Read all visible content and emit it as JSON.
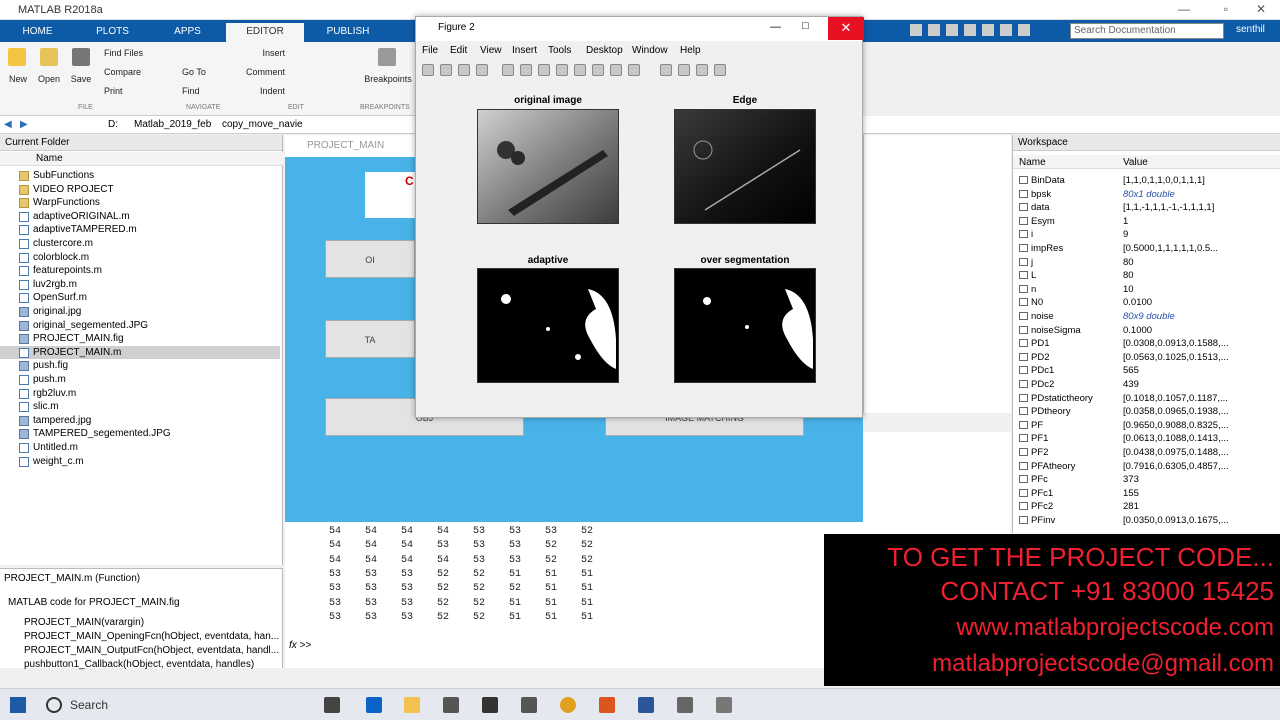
{
  "app": {
    "title": "MATLAB R2018a",
    "tabs": [
      "HOME",
      "PLOTS",
      "APPS",
      "EDITOR",
      "PUBLISH"
    ],
    "active_tab": "EDITOR",
    "search_placeholder": "Search Documentation",
    "user": "senthil"
  },
  "ribbon": {
    "new": "New",
    "open": "Open",
    "save": "Save",
    "find_files": "Find Files",
    "compare": "Compare",
    "print": "Print",
    "go_to": "Go To",
    "find": "Find",
    "comment": "Comment",
    "insert": "Insert",
    "indent": "Indent",
    "breakpoints": "Breakpoints",
    "sections": [
      "FILE",
      "NAVIGATE",
      "EDIT",
      "BREAKPOINTS"
    ]
  },
  "path": [
    "D:",
    "Matlab_2019_feb",
    "copy_move_navie"
  ],
  "current_folder": {
    "title": "Current Folder",
    "col_name": "Name",
    "items": [
      {
        "name": "SubFunctions",
        "type": "folder"
      },
      {
        "name": "VIDEO RPOJECT",
        "type": "folder"
      },
      {
        "name": "WarpFunctions",
        "type": "folder"
      },
      {
        "name": "adaptiveORIGINAL.m",
        "type": "m"
      },
      {
        "name": "adaptiveTAMPERED.m",
        "type": "m"
      },
      {
        "name": "clustercore.m",
        "type": "m"
      },
      {
        "name": "colorblock.m",
        "type": "m"
      },
      {
        "name": "featurepoints.m",
        "type": "m"
      },
      {
        "name": "luv2rgb.m",
        "type": "m"
      },
      {
        "name": "OpenSurf.m",
        "type": "m"
      },
      {
        "name": "original.jpg",
        "type": "img"
      },
      {
        "name": "original_segemented.JPG",
        "type": "img"
      },
      {
        "name": "PROJECT_MAIN.fig",
        "type": "img"
      },
      {
        "name": "PROJECT_MAIN.m",
        "type": "m",
        "selected": true
      },
      {
        "name": "push.fig",
        "type": "img"
      },
      {
        "name": "push.m",
        "type": "m"
      },
      {
        "name": "rgb2luv.m",
        "type": "m"
      },
      {
        "name": "slic.m",
        "type": "m"
      },
      {
        "name": "tampered.jpg",
        "type": "img"
      },
      {
        "name": "TAMPERED_segemented.JPG",
        "type": "img"
      },
      {
        "name": "Untitled.m",
        "type": "m"
      },
      {
        "name": "weight_c.m",
        "type": "m"
      }
    ]
  },
  "details": {
    "header": "PROJECT_MAIN.m  (Function)",
    "desc": "MATLAB code for PROJECT_MAIN.fig",
    "lines": [
      "PROJECT_MAIN(varargin)",
      "PROJECT_MAIN_OpeningFcn(hObject, eventdata, han...",
      "PROJECT_MAIN_OutputFcn(hObject, eventdata, handl...",
      "pushbutton1_Callback(hObject, eventdata, handles)"
    ]
  },
  "project_window": {
    "title": "PROJECT_MAIN",
    "buttons": [
      "C",
      "OI",
      "TA",
      "OBJ",
      "IMAGE MATCHING"
    ]
  },
  "figure": {
    "title": "Figure 2",
    "menu": [
      "File",
      "Edit",
      "View",
      "Insert",
      "Tools",
      "Desktop",
      "Window",
      "Help"
    ],
    "subplots": [
      "original image",
      "Edge",
      "adaptive",
      "over segmentation"
    ]
  },
  "command_window": {
    "rows": [
      "54    54    54    54    53    53    53    52",
      "54    54    54    53    53    53    52    52",
      "54    54    54    54    53    53    52    52",
      "53    53    53    52    52    51    51    51",
      "53    53    53    52    52    52    51    51",
      "53    53    53    52    52    51    51    51",
      "53    53    53    52    52    51    51    51"
    ],
    "prompt": "fx >>"
  },
  "workspace": {
    "title": "Workspace",
    "col_name": "Name",
    "col_value": "Value",
    "vars": [
      [
        "BinData",
        "[1,1,0,1,1,0,0,1,1,1]"
      ],
      [
        "bpsk",
        "80x1 double"
      ],
      [
        "data",
        "[1,1,-1,1,1,-1,-1,1,1,1]"
      ],
      [
        "Esym",
        "1"
      ],
      [
        "i",
        "9"
      ],
      [
        "impRes",
        "[0.5000,1,1,1,1,1,0.5..."
      ],
      [
        "j",
        "80"
      ],
      [
        "L",
        "80"
      ],
      [
        "n",
        "10"
      ],
      [
        "N0",
        "0.0100"
      ],
      [
        "noise",
        "80x9 double"
      ],
      [
        "noiseSigma",
        "0.1000"
      ],
      [
        "PD1",
        "[0.0308,0.0913,0.1588,..."
      ],
      [
        "PD2",
        "[0.0563,0.1025,0.1513,..."
      ],
      [
        "PDc1",
        "565"
      ],
      [
        "PDc2",
        "439"
      ],
      [
        "PDstatictheory",
        "[0.1018,0.1057,0.1187,..."
      ],
      [
        "PDtheory",
        "[0.0358,0.0965,0.1938,..."
      ],
      [
        "PF",
        "[0.9650,0.9088,0.8325,..."
      ],
      [
        "PF1",
        "[0.0613,0.1088,0.1413,..."
      ],
      [
        "PF2",
        "[0.0438,0.0975,0.1488,..."
      ],
      [
        "PFAtheory",
        "[0.7916,0.6305,0.4857,..."
      ],
      [
        "PFc",
        "373"
      ],
      [
        "PFc1",
        "155"
      ],
      [
        "PFc2",
        "281"
      ],
      [
        "PFinv",
        "[0.0350,0.0913,0.1675,..."
      ]
    ]
  },
  "overlay": [
    "TO GET THE PROJECT CODE...",
    "CONTACT +91 83000 15425",
    "www.matlabprojectscode.com",
    "matlabprojectscode@gmail.com"
  ],
  "taskbar": {
    "search": "Search"
  }
}
